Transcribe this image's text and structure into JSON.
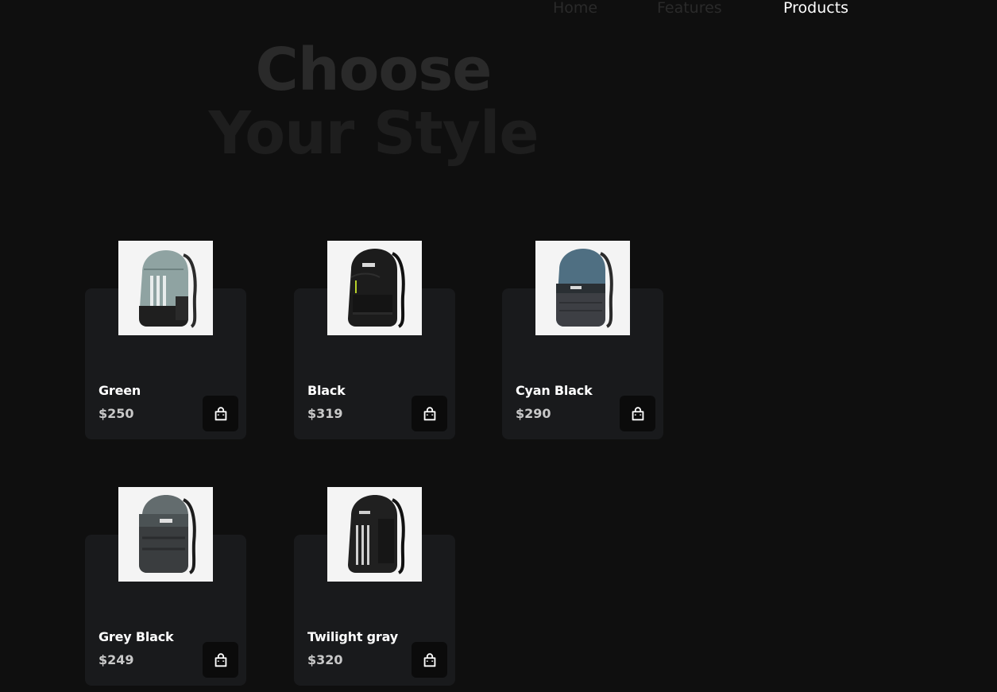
{
  "nav": {
    "home": "Home",
    "features": "Features",
    "products": "Products"
  },
  "hero": {
    "line1": "Choose",
    "line2": "Your Style"
  },
  "products": [
    {
      "name": "Green",
      "price": "$250",
      "image": "green-backpack",
      "color": "#8fa3a2"
    },
    {
      "name": "Black",
      "price": "$319",
      "image": "black-backpack",
      "color": "#1c1c1c"
    },
    {
      "name": "Cyan Black",
      "price": "$290",
      "image": "cyan-black-backpack",
      "color": "#4f6f82"
    },
    {
      "name": "Grey Black",
      "price": "$249",
      "image": "grey-black-backpack",
      "color": "#636c6e"
    },
    {
      "name": "Twilight gray",
      "price": "$320",
      "image": "twilight-gray-backpack",
      "color": "#202020"
    }
  ],
  "icons": {
    "cart": "shopping-bag-icon"
  }
}
